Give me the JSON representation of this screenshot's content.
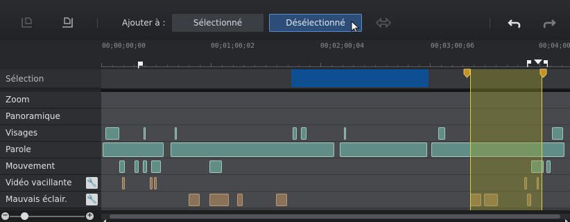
{
  "toolbar": {
    "add_to_label": "Ajouter à :",
    "select_button": "Sélectionné",
    "deselect_button": "Désélectionné"
  },
  "ruler": {
    "timecodes": [
      "00;00;00;00",
      "00;01;00;02",
      "00;02;00;04",
      "00;03;00;06",
      "00;04;00"
    ]
  },
  "tracks": [
    {
      "label": "Sélection",
      "has_wrench": false
    },
    {
      "label": "Zoom",
      "has_wrench": false
    },
    {
      "label": "Panoramique",
      "has_wrench": false
    },
    {
      "label": "Visages",
      "has_wrench": false
    },
    {
      "label": "Parole",
      "has_wrench": false
    },
    {
      "label": "Mouvement",
      "has_wrench": false
    },
    {
      "label": "Vidéo vacillante",
      "has_wrench": true
    },
    {
      "label": "Mauvais éclair.",
      "has_wrench": true
    }
  ],
  "icons": {
    "undo": "undo-icon",
    "redo": "redo-icon",
    "zoom_out": "zoom-out-icon",
    "zoom_in": "zoom-in-icon",
    "settings": "wrench-icon"
  },
  "colors": {
    "selection_clip": "#0e4e93",
    "detected_clip": "#5f8e86",
    "lighting_clip": "#8a7258",
    "range_highlight": "#d8d34a",
    "deselect_button": "#2c4d78"
  }
}
